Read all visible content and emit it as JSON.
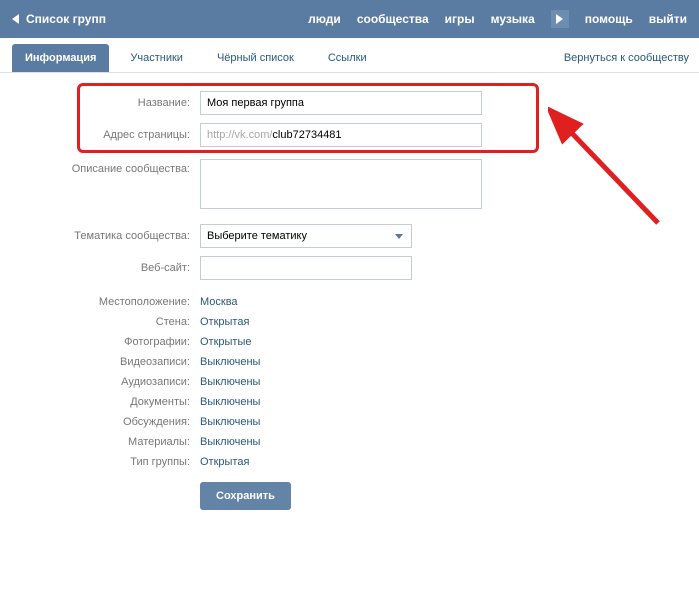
{
  "topbar": {
    "title": "Список групп",
    "nav": [
      "люди",
      "сообщества",
      "игры",
      "музыка"
    ],
    "help": "помощь",
    "logout": "выйти"
  },
  "tabs": {
    "items": [
      "Информация",
      "Участники",
      "Чёрный список",
      "Ссылки"
    ],
    "back": "Вернуться к сообществу"
  },
  "form": {
    "name_label": "Название:",
    "name_value": "Моя первая группа",
    "addr_label": "Адрес страницы:",
    "addr_prefix": "http://vk.com/",
    "addr_value": "club72734481",
    "desc_label": "Описание сообщества:",
    "desc_value": "",
    "theme_label": "Тематика сообщества:",
    "theme_value": "Выберите тематику",
    "site_label": "Веб-сайт:",
    "site_value": "",
    "rows": [
      {
        "label": "Местоположение:",
        "value": "Москва"
      },
      {
        "label": "Стена:",
        "value": "Открытая"
      },
      {
        "label": "Фотографии:",
        "value": "Открытые"
      },
      {
        "label": "Видеозаписи:",
        "value": "Выключены"
      },
      {
        "label": "Аудиозаписи:",
        "value": "Выключены"
      },
      {
        "label": "Документы:",
        "value": "Выключены"
      },
      {
        "label": "Обсуждения:",
        "value": "Выключены"
      },
      {
        "label": "Материалы:",
        "value": "Выключены"
      },
      {
        "label": "Тип группы:",
        "value": "Открытая"
      }
    ],
    "save": "Сохранить"
  },
  "colors": {
    "header_bg": "#5b7ca2",
    "link": "#2b587a",
    "highlight": "#e02020"
  }
}
